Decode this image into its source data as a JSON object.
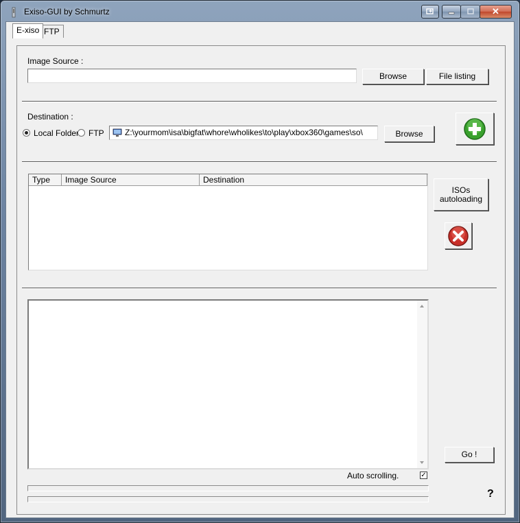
{
  "window": {
    "title": "Exiso-GUI by Schmurtz",
    "caption_buttons": {
      "restore_icon": "restore-down-icon",
      "minimize_icon": "minimize-icon",
      "maximize_icon": "maximize-icon",
      "close_icon": "close-icon"
    }
  },
  "tabs": [
    {
      "label": "E-xiso",
      "active": true
    },
    {
      "label": "FTP",
      "active": false
    }
  ],
  "source": {
    "label": "Image Source :",
    "value": "",
    "browse_label": "Browse",
    "file_listing_label": "File listing"
  },
  "destination": {
    "label": "Destination :",
    "radio_local": "Local Folder",
    "radio_ftp": "FTP",
    "selected": "Local Folder",
    "path": "Z:\\yourmom\\isa\\bigfat\\whore\\wholikes\\to\\play\\xbox360\\games\\so\\",
    "browse_label": "Browse",
    "add_icon": "add-plus-icon"
  },
  "queue": {
    "columns": [
      "Type",
      "Image Source",
      "Destination"
    ],
    "rows": [],
    "autoload_label": "ISOs\nautoloading",
    "delete_icon": "delete-x-icon"
  },
  "log": {
    "text": "",
    "auto_scroll_label": "Auto scrolling.",
    "auto_scroll_checked": true,
    "go_label": "Go !",
    "help_label": "?"
  },
  "colors": {
    "add_green": "#3aa12e",
    "delete_red": "#c8302a"
  }
}
